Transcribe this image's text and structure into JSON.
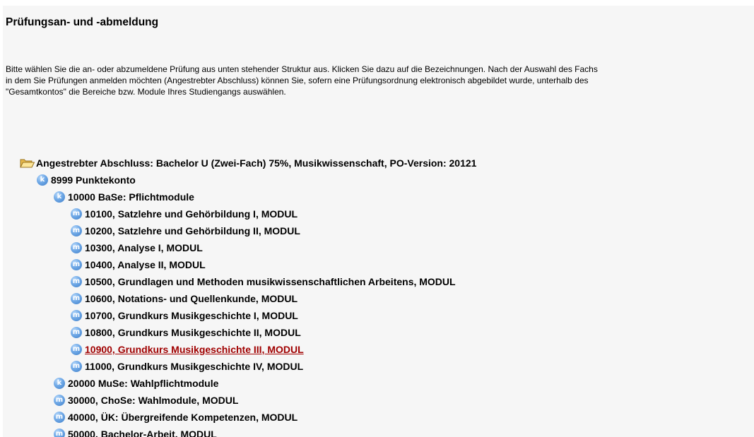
{
  "page": {
    "title": "Prüfungsan- und -abmeldung",
    "intro_lines": [
      "Bitte wählen Sie die an- oder abzumeldene Prüfung aus unten stehender Struktur aus. Klicken Sie dazu auf die Bezeichnungen. Nach der Auswahl des Fachs",
      "in dem Sie Prüfungen anmelden möchten (Angestrebter Abschluss) können Sie, sofern eine Prüfungsordnung elektronisch abgebildet wurde, unterhalb des",
      "\"Gesamtkontos\" die Bereiche bzw. Module Ihres Studiengangs auswählen."
    ]
  },
  "icons": {
    "folder": "folder-icon",
    "konto": "konto-icon",
    "konto_glyph": "k",
    "modul": "modul-icon",
    "modul_glyph": "m"
  },
  "tree": {
    "root": {
      "label": "Angestrebter Abschluss: Bachelor U (Zwei-Fach) 75%, Musikwissenschaft, PO-Version: 20121"
    },
    "konto": {
      "label": "8999 Punktekonto"
    },
    "pflicht": {
      "label": "10000 BaSe: Pflichtmodule"
    },
    "pflicht_modules": [
      {
        "label": "10100, Satzlehre und Gehörbildung I, MODUL"
      },
      {
        "label": "10200, Satzlehre und Gehörbildung II, MODUL"
      },
      {
        "label": "10300, Analyse I, MODUL"
      },
      {
        "label": "10400, Analyse II, MODUL"
      },
      {
        "label": "10500, Grundlagen und Methoden musikwissenschaftlichen Arbeitens, MODUL"
      },
      {
        "label": "10600, Notations- und Quellenkunde, MODUL"
      },
      {
        "label": "10700, Grundkurs Musikgeschichte I, MODUL"
      },
      {
        "label": "10800, Grundkurs Musikgeschichte II, MODUL"
      },
      {
        "label": "10900, Grundkurs Musikgeschichte III, MODUL",
        "state": "hovered"
      },
      {
        "label": "11000, Grundkurs Musikgeschichte IV, MODUL"
      }
    ],
    "wahlpflicht": {
      "label": "20000 MuSe: Wahlpflichtmodule"
    },
    "top_modules": [
      {
        "label": "30000, ChoSe: Wahlmodule, MODUL"
      },
      {
        "label": "40000, ÜK: Übergreifende Kompetenzen, MODUL"
      },
      {
        "label": "50000, Bachelor-Arbeit, MODUL"
      }
    ]
  },
  "colors": {
    "background": "#f6f6f6",
    "text": "#000000",
    "active_link": "#a00000",
    "icon_blue": "#5b96d8"
  }
}
